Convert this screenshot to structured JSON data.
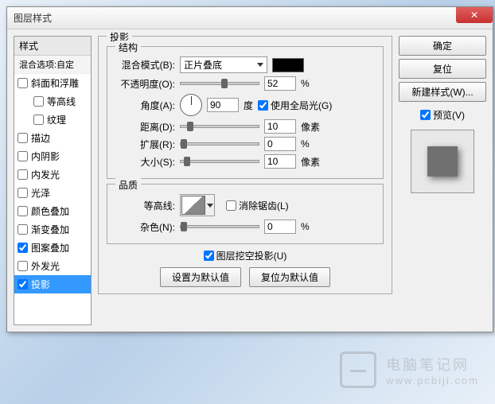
{
  "window": {
    "title": "图层样式"
  },
  "leftPanel": {
    "header": "样式",
    "subheader": "混合选项:自定",
    "items": [
      {
        "label": "斜面和浮雕",
        "checked": false,
        "indent": false
      },
      {
        "label": "等高线",
        "checked": false,
        "indent": true
      },
      {
        "label": "纹理",
        "checked": false,
        "indent": true
      },
      {
        "label": "描边",
        "checked": false,
        "indent": false
      },
      {
        "label": "内阴影",
        "checked": false,
        "indent": false
      },
      {
        "label": "内发光",
        "checked": false,
        "indent": false
      },
      {
        "label": "光泽",
        "checked": false,
        "indent": false
      },
      {
        "label": "颜色叠加",
        "checked": false,
        "indent": false
      },
      {
        "label": "渐变叠加",
        "checked": false,
        "indent": false
      },
      {
        "label": "图案叠加",
        "checked": true,
        "indent": false
      },
      {
        "label": "外发光",
        "checked": false,
        "indent": false
      },
      {
        "label": "投影",
        "checked": true,
        "indent": false,
        "selected": true
      }
    ]
  },
  "mainSection": {
    "title": "投影",
    "structure": {
      "title": "结构",
      "blendMode": {
        "label": "混合模式(B):",
        "value": "正片叠底",
        "color": "#000000"
      },
      "opacity": {
        "label": "不透明度(O):",
        "value": "52",
        "unit": "%",
        "pos": 52
      },
      "angle": {
        "label": "角度(A):",
        "value": "90",
        "unit": "度"
      },
      "globalLight": {
        "label": "使用全局光(G)",
        "checked": true
      },
      "distance": {
        "label": "距离(D):",
        "value": "10",
        "unit": "像素",
        "pos": 8
      },
      "spread": {
        "label": "扩展(R):",
        "value": "0",
        "unit": "%",
        "pos": 0
      },
      "size": {
        "label": "大小(S):",
        "value": "10",
        "unit": "像素",
        "pos": 4
      }
    },
    "quality": {
      "title": "品质",
      "contour": {
        "label": "等高线:"
      },
      "antialias": {
        "label": "消除锯齿(L)",
        "checked": false
      },
      "noise": {
        "label": "杂色(N):",
        "value": "0",
        "unit": "%",
        "pos": 0
      }
    },
    "knockout": {
      "label": "图层挖空投影(U)",
      "checked": true
    },
    "buttons": {
      "default": "设置为默认值",
      "reset": "复位为默认值"
    }
  },
  "rightPanel": {
    "ok": "确定",
    "cancel": "复位",
    "newStyle": "新建样式(W)...",
    "preview": {
      "label": "预览(V)",
      "checked": true
    }
  },
  "watermark": {
    "line1": "电脑笔记网",
    "line2": "www.pcbiji.com"
  }
}
